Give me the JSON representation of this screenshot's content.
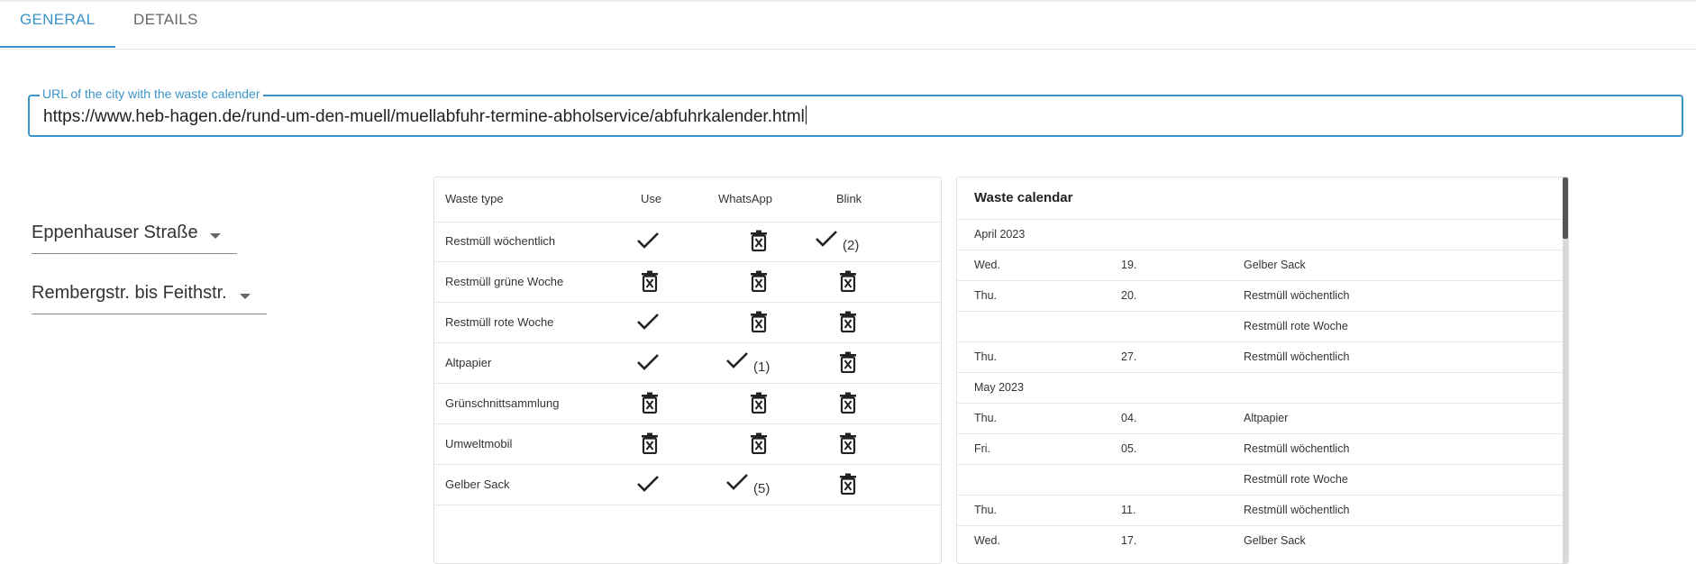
{
  "tabs": [
    {
      "label": "GENERAL"
    },
    {
      "label": "DETAILS"
    }
  ],
  "url_field": {
    "label": "URL of the city with the waste calender",
    "value": "https://www.heb-hagen.de/rund-um-den-muell/muellabfuhr-termine-abholservice/abfuhrkalender.html"
  },
  "street_select": {
    "value": "Eppenhauser Straße"
  },
  "section_select": {
    "value": "Rembergstr. bis Feithstr."
  },
  "waste_table": {
    "headers": [
      "Waste type",
      "Use",
      "WhatsApp",
      "Blink"
    ],
    "rows": [
      {
        "type": "Restmüll wöchentlich",
        "use": "check",
        "whatsapp": "trash",
        "blink": "check",
        "blink_note": "(2)"
      },
      {
        "type": "Restmüll grüne Woche",
        "use": "trash",
        "whatsapp": "trash",
        "blink": "trash"
      },
      {
        "type": "Restmüll rote Woche",
        "use": "check",
        "whatsapp": "trash",
        "blink": "trash"
      },
      {
        "type": "Altpapier",
        "use": "check",
        "whatsapp": "check",
        "whatsapp_note": "(1)",
        "blink": "trash"
      },
      {
        "type": "Grünschnittsammlung",
        "use": "trash",
        "whatsapp": "trash",
        "blink": "trash"
      },
      {
        "type": "Umweltmobil",
        "use": "trash",
        "whatsapp": "trash",
        "blink": "trash"
      },
      {
        "type": "Gelber Sack",
        "use": "check",
        "whatsapp": "check",
        "whatsapp_note": "(5)",
        "blink": "trash"
      }
    ]
  },
  "calendar": {
    "title": "Waste calendar",
    "rows": [
      {
        "kind": "month",
        "label": "April 2023"
      },
      {
        "kind": "entry",
        "day": "Wed.",
        "date": "19.",
        "type": "Gelber Sack"
      },
      {
        "kind": "entry",
        "day": "Thu.",
        "date": "20.",
        "type": "Restmüll wöchentlich"
      },
      {
        "kind": "entry",
        "day": "",
        "date": "",
        "type": "Restmüll rote Woche"
      },
      {
        "kind": "entry",
        "day": "Thu.",
        "date": "27.",
        "type": "Restmüll wöchentlich"
      },
      {
        "kind": "month",
        "label": "May 2023"
      },
      {
        "kind": "entry",
        "day": "Thu.",
        "date": "04.",
        "type": "Altpapier"
      },
      {
        "kind": "entry",
        "day": "Fri.",
        "date": "05.",
        "type": "Restmüll wöchentlich"
      },
      {
        "kind": "entry",
        "day": "",
        "date": "",
        "type": "Restmüll rote Woche"
      },
      {
        "kind": "entry",
        "day": "Thu.",
        "date": "11.",
        "type": "Restmüll wöchentlich"
      },
      {
        "kind": "entry",
        "day": "Wed.",
        "date": "17.",
        "type": "Gelber Sack"
      }
    ]
  },
  "colors": {
    "accent": "#3a95c9"
  }
}
